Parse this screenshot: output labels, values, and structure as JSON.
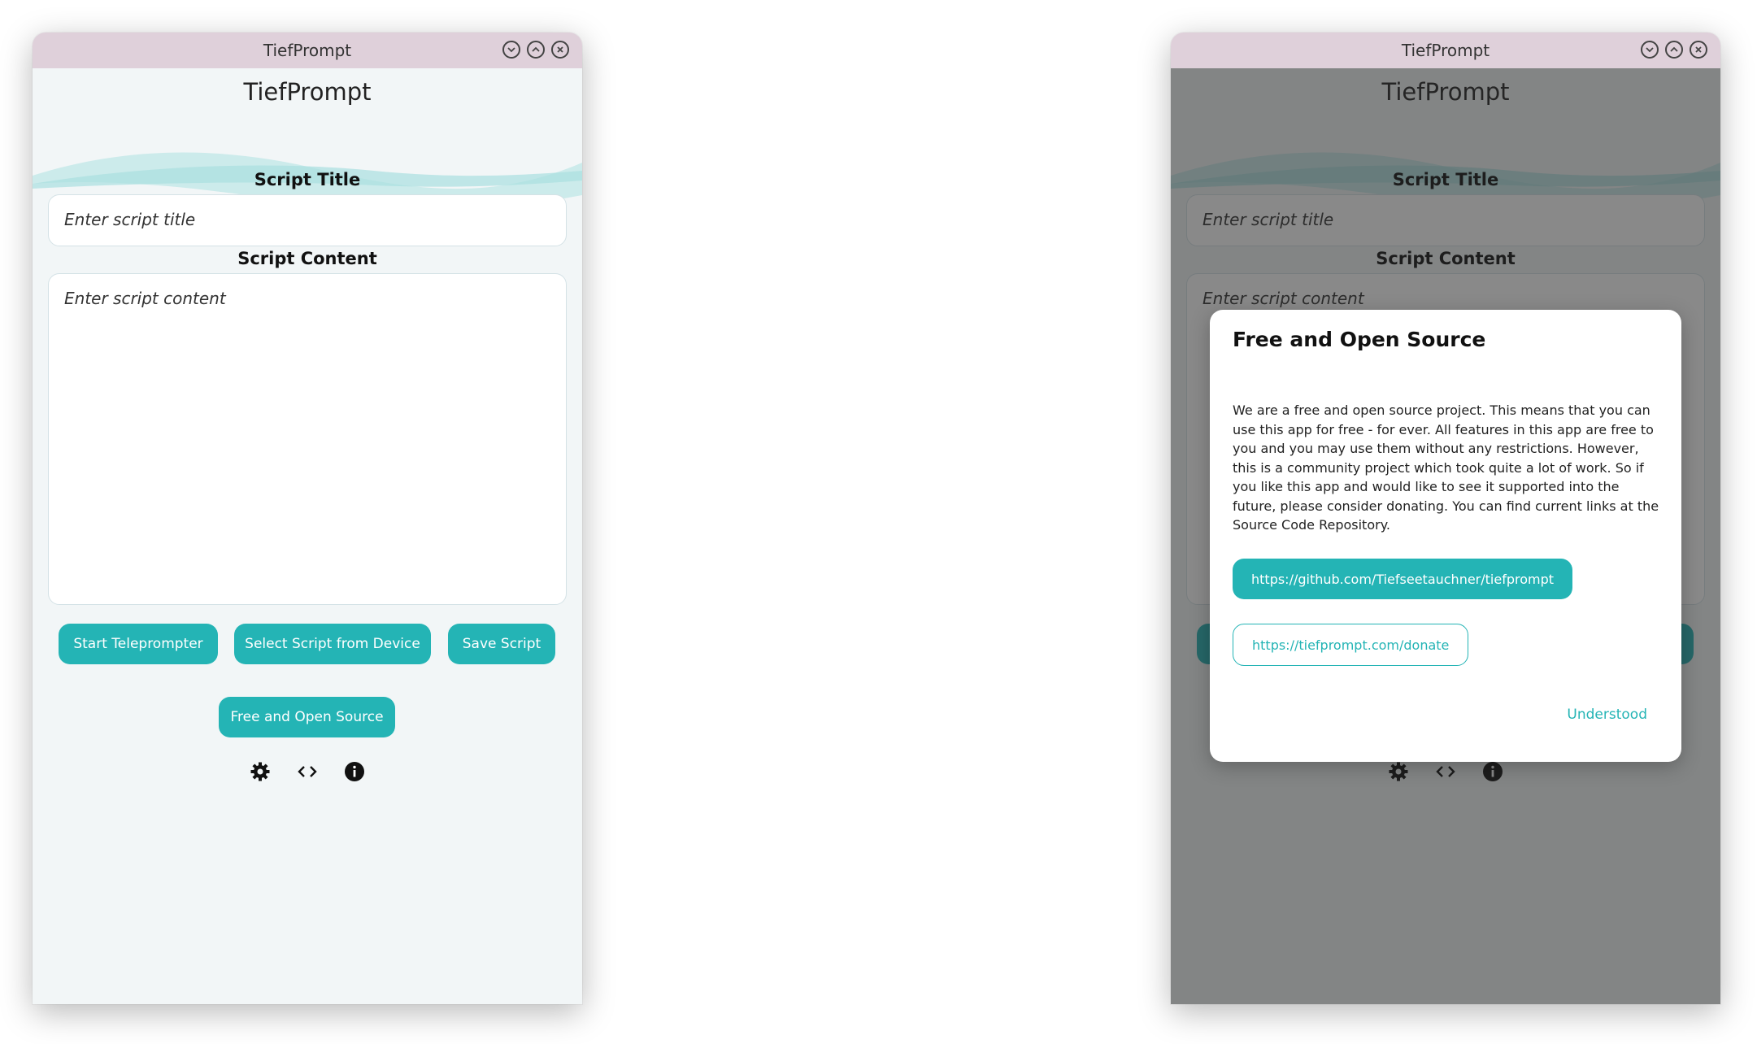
{
  "window": {
    "title": "TiefPrompt"
  },
  "app": {
    "title": "TiefPrompt"
  },
  "form": {
    "title_label": "Script Title",
    "title_placeholder": "Enter script title",
    "content_label": "Script Content",
    "content_placeholder": "Enter script content"
  },
  "buttons": {
    "start": "Start Teleprompter",
    "select": "Select Script from Device",
    "save": "Save Script",
    "foss": "Free and Open Source"
  },
  "icons": [
    "gear-icon",
    "code-icon",
    "info-icon"
  ],
  "dialog": {
    "title": "Free and Open Source",
    "body": "We are a free and open source project. This means that you can use this app for free - for ever. All features in this app are free to you and you may use them without any restrictions. However, this is a community project which took quite a lot of work. So if you like this app and would like to see it supported into the future, please consider donating. You can find current links at the Source Code Repository.",
    "link_repo": "https://github.com/Tiefseetauchner/tiefprompt",
    "link_donate": "https://tiefprompt.com/donate",
    "confirm": "Understood"
  },
  "colors": {
    "accent": "#24b4b5",
    "titlebar": "#dfd0da",
    "background": "#f2f6f7"
  }
}
